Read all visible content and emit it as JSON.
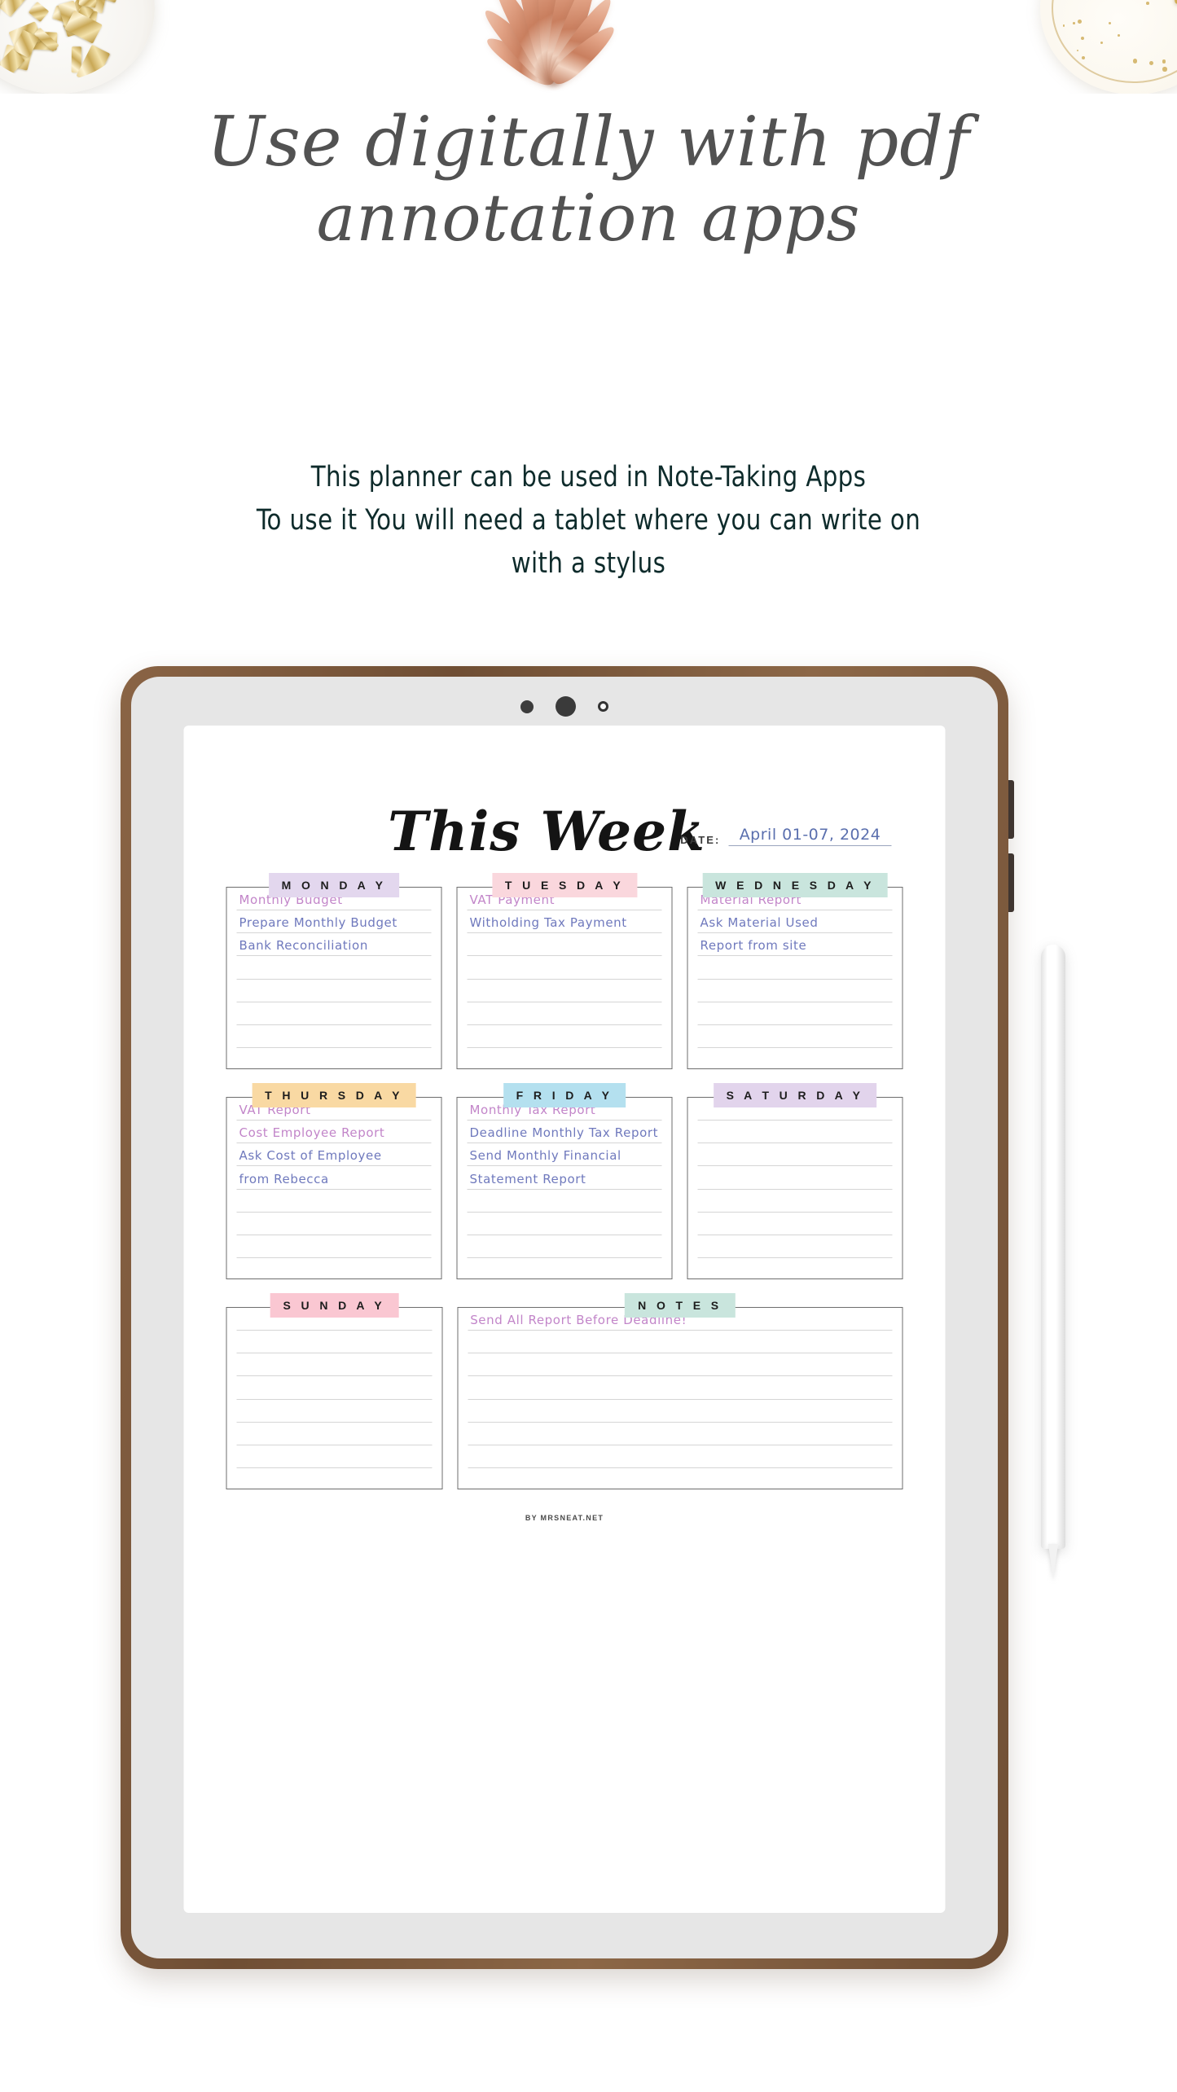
{
  "hero": {
    "script_line1": "Use digitally with pdf",
    "script_line2": "annotation apps",
    "subtitle_line1": "This planner can be used in Note-Taking Apps",
    "subtitle_line2": "To use it You will need a tablet where you can write on",
    "subtitle_line3": "with a stylus"
  },
  "props": {
    "left": "gold-binder-clips-in-dish",
    "center": "rose-gold-monstera-leaf",
    "right": "gold-clip-on-plate"
  },
  "device": {
    "type": "tablet",
    "frame_color": "#7a573b",
    "bezel_color": "#e6e6e6",
    "stylus": "white-stylus-pen"
  },
  "planner": {
    "title": "This Week",
    "date_label": "DATE:",
    "date_value": "April 01-07, 2024",
    "footer": "BY MRSNEAT.NET",
    "line_count": 7,
    "notes_line_count": 7,
    "colors": {
      "monday": "#e3d7ee",
      "tuesday": "#fad7dd",
      "wednesday": "#c9e5dd",
      "thursday": "#f9d9a3",
      "friday": "#b4e0ef",
      "saturday": "#e2d4ec",
      "sunday": "#fac7d2",
      "notes": "#c9e5dd",
      "text_pink": "#c285c9",
      "text_blue": "#6f79bd",
      "date_text": "#5a6fae"
    },
    "days": [
      {
        "label": "M O N D A Y",
        "entries": [
          {
            "text": "Monthly Budget",
            "tone": "pink"
          },
          {
            "text": "Prepare Monthly Budget",
            "tone": "blue"
          },
          {
            "text": "Bank Reconciliation",
            "tone": "blue"
          }
        ]
      },
      {
        "label": "T U E S D A Y",
        "entries": [
          {
            "text": "VAT Payment",
            "tone": "pink"
          },
          {
            "text": "Witholding Tax Payment",
            "tone": "blue"
          }
        ]
      },
      {
        "label": "W E D N E S D A Y",
        "entries": [
          {
            "text": "Material Report",
            "tone": "pink"
          },
          {
            "text": "Ask Material Used",
            "tone": "blue"
          },
          {
            "text": "Report from site",
            "tone": "blue"
          }
        ]
      },
      {
        "label": "T H U R S D A Y",
        "entries": [
          {
            "text": "VAT Report",
            "tone": "pink"
          },
          {
            "text": "Cost Employee Report",
            "tone": "pink"
          },
          {
            "text": "Ask Cost of Employee",
            "tone": "blue"
          },
          {
            "text": "from Rebecca",
            "tone": "blue"
          }
        ]
      },
      {
        "label": "F R I D A Y",
        "entries": [
          {
            "text": "Monthly Tax Report",
            "tone": "pink"
          },
          {
            "text": "Deadline Monthly Tax Report",
            "tone": "blue"
          },
          {
            "text": "Send Monthly Financial",
            "tone": "blue"
          },
          {
            "text": "Statement Report",
            "tone": "blue"
          }
        ]
      },
      {
        "label": "S A T U R D A Y",
        "entries": []
      },
      {
        "label": "S U N D A Y",
        "entries": []
      },
      {
        "label": "N O T E S",
        "entries": [
          {
            "text": "Send All Report Before Deadline!",
            "tone": "pink"
          }
        ]
      }
    ]
  }
}
